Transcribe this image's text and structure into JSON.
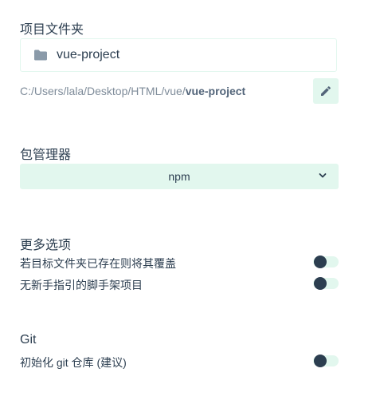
{
  "folder_section": {
    "title": "项目文件夹",
    "folder_name": "vue-project",
    "path_prefix": "C:/Users/lala/Desktop/HTML/vue/",
    "path_folder": "vue-project"
  },
  "package_manager": {
    "title": "包管理器",
    "selected": "npm"
  },
  "more_options": {
    "title": "更多选项",
    "items": [
      {
        "label": "若目标文件夹已存在则将其覆盖",
        "enabled": false
      },
      {
        "label": "无新手指引的脚手架项目",
        "enabled": false
      }
    ]
  },
  "git": {
    "title": "Git",
    "init_label": "初始化 git 仓库 (建议)",
    "enabled": false
  },
  "colors": {
    "accent_light": "#e2f7ee",
    "text_dark": "#2c3e50",
    "text_muted": "#7f8c9a"
  },
  "icons": {
    "folder": "folder-icon",
    "edit": "pencil-icon",
    "dropdown": "chevron-down-icon"
  }
}
